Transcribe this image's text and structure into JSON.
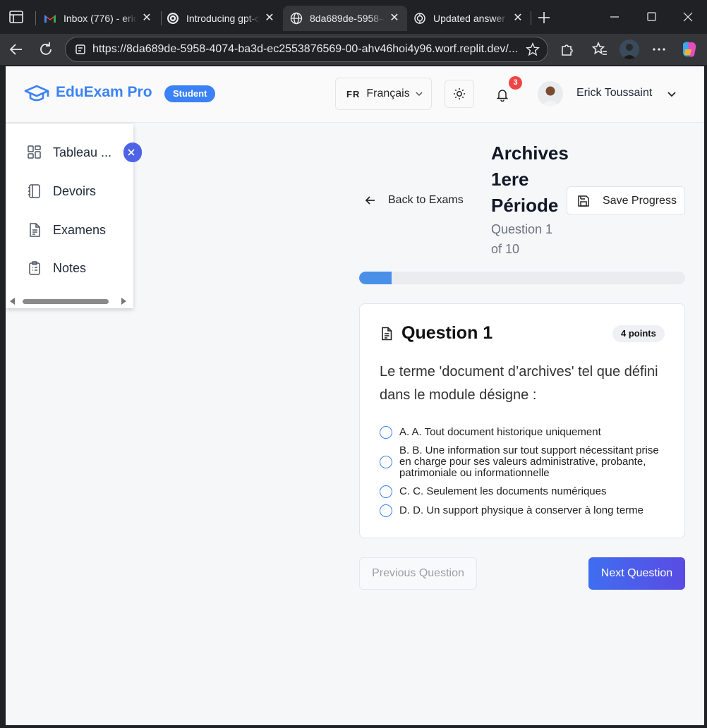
{
  "browser": {
    "tabs": [
      {
        "label": "Inbox (776) - erick",
        "icon": "gmail-icon"
      },
      {
        "label": "Introducing gpt-oss",
        "icon": "openai-icon"
      },
      {
        "label": "8da689de-5958-4074",
        "icon": "globe-icon",
        "active": true
      },
      {
        "label": "Updated answer to",
        "icon": "openai-icon"
      }
    ],
    "url": "https://8da689de-5958-4074-ba3d-ec2553876569-00-ahv46hoi4y96.worf.replit.dev/..."
  },
  "header": {
    "brand": "EduExam Pro",
    "role": "Student",
    "lang_code": "FR",
    "lang_label": "Français",
    "notification_count": "3",
    "user_name": "Erick Toussaint"
  },
  "sidebar": {
    "items": [
      {
        "label": "Tableau ...",
        "icon": "dashboard-icon"
      },
      {
        "label": "Devoirs",
        "icon": "notebook-icon"
      },
      {
        "label": "Examens",
        "icon": "document-icon"
      },
      {
        "label": "Notes",
        "icon": "clipboard-list-icon"
      }
    ]
  },
  "exam": {
    "back_label": "Back to Exams",
    "title": "Archives 1ere Période",
    "subtitle": "Question 1 of 10",
    "save_label": "Save Progress",
    "progress_fraction": 0.1
  },
  "question": {
    "title": "Question 1",
    "points": "4 points",
    "text": "Le terme 'document d’archives' tel que défini dans le module désigne :",
    "options": [
      "A. A. Tout document historique uniquement",
      "B. B. Une information sur tout support nécessitant prise en charge pour ses valeurs administrative, probante, patrimoniale ou informationnelle",
      "C. C. Seulement les documents numériques",
      "D. D. Un support physique à conserver à long terme"
    ]
  },
  "nav": {
    "prev_label": "Previous Question",
    "next_label": "Next Question"
  },
  "colors": {
    "accent": "#3b82f6",
    "next_gradient_start": "#3f6ef0",
    "next_gradient_end": "#5a4be3",
    "badge_red": "#ef4444"
  }
}
